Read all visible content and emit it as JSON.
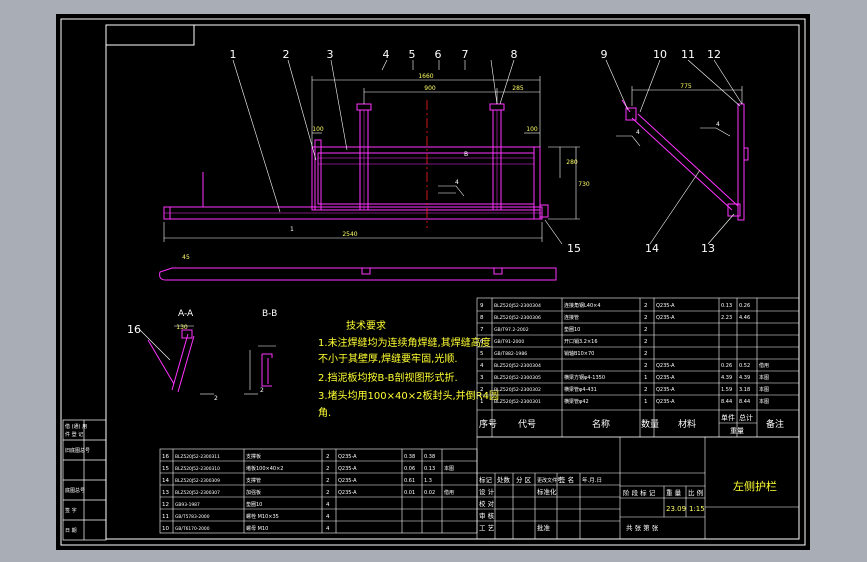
{
  "drawing": {
    "title_block_name": "左侧护栏",
    "weight_value": "23.09",
    "scale_value": "1:15",
    "sheet_text": "共  张  第  张",
    "tech_req_title": "技术要求",
    "tech_req": [
      "1.未注焊缝均为连续角焊缝,其焊缝高度",
      "不小于其壁厚,焊缝要牢固,光顺.",
      "2.挡泥板均按B-B剖视图形式折.",
      "3.堵头均用100×40×2板封头,并倒R4圆",
      "角."
    ],
    "section_aa": "A-A",
    "section_bb": "B-B",
    "section_b_marker": "B",
    "balloons_top": [
      "1",
      "2",
      "3",
      "4",
      "5",
      "6",
      "7",
      "8"
    ],
    "balloons_right": [
      "9",
      "10",
      "11",
      "12"
    ],
    "balloons_other": [
      "15",
      "14",
      "13",
      "16"
    ],
    "dims": {
      "overall": "1660",
      "d900": "900",
      "d285": "285",
      "d2540": "2540",
      "d100a": "100",
      "d100b": "100",
      "d280": "280",
      "d730": "730",
      "d775": "775",
      "d130": "130",
      "d45": "45",
      "r4": "4",
      "r2": "2",
      "r1": "1"
    },
    "parts_table": {
      "rows": [
        {
          "no": "9",
          "code": "BLZ520J52-2300304",
          "name": "连接角钢L40×4",
          "qty": "2",
          "mat": "Q235-A",
          "w1": "0.13",
          "w2": "0.26",
          "note": ""
        },
        {
          "no": "8",
          "code": "BLZ520J52-2300306",
          "name": "连接管",
          "qty": "2",
          "mat": "Q235-A",
          "w1": "2.23",
          "w2": "4.46",
          "note": ""
        },
        {
          "no": "7",
          "code": "GB/T97.2-2002",
          "name": "垫圈10",
          "qty": "2",
          "mat": "",
          "w1": "",
          "w2": "",
          "note": ""
        },
        {
          "no": "6",
          "code": "GB/T91-2000",
          "name": "开口销3.2×16",
          "qty": "2",
          "mat": "",
          "w1": "",
          "w2": "",
          "note": ""
        },
        {
          "no": "5",
          "code": "GB/T882-1986",
          "name": "销轴B10×70",
          "qty": "2",
          "mat": "",
          "w1": "",
          "w2": "",
          "note": ""
        },
        {
          "no": "4",
          "code": "BLZ520J52-2300304",
          "name": "",
          "qty": "2",
          "mat": "Q235-A",
          "w1": "0.26",
          "w2": "0.52",
          "note": "借用"
        },
        {
          "no": "3",
          "code": "BLZ520J52-2300305",
          "name": "横梁方钢φ4-1350",
          "qty": "1",
          "mat": "Q235-A",
          "w1": "4.39",
          "w2": "4.39",
          "note": "本图"
        },
        {
          "no": "2",
          "code": "BLZ520J52-2300302",
          "name": "横梁管φ4-431",
          "qty": "2",
          "mat": "Q235-A",
          "w1": "1.59",
          "w2": "3.18",
          "note": "本图"
        },
        {
          "no": "1",
          "code": "BLZ520J52-2300301",
          "name": "横梁管φ42",
          "qty": "1",
          "mat": "Q235-A",
          "w1": "8.44",
          "w2": "8.44",
          "note": "本图"
        }
      ],
      "headers": {
        "no": "序号",
        "code": "代号",
        "name": "名称",
        "qty": "数量",
        "mat": "材料",
        "single": "单件",
        "total": "总计",
        "weight": "重量",
        "note": "备注"
      }
    },
    "lower_table": {
      "rows": [
        {
          "no": "16",
          "code": "BLZ520J52-2300311",
          "name": "支撑板",
          "qty": "2",
          "mat": "Q235-A",
          "w1": "0.38",
          "w2": "0.38",
          "note": ""
        },
        {
          "no": "15",
          "code": "BLZ520J52-2300310",
          "name": "堵板100×40×2",
          "qty": "2",
          "mat": "Q235-A",
          "w1": "0.06",
          "w2": "0.13",
          "note": "本图"
        },
        {
          "no": "14",
          "code": "BLZ520J52-2300309",
          "name": "支撑管",
          "qty": "2",
          "mat": "Q235-A",
          "w1": "0.61",
          "w2": "1.3",
          "note": ""
        },
        {
          "no": "13",
          "code": "BLZ520J52-2300307",
          "name": "加强板",
          "qty": "2",
          "mat": "Q235-A",
          "w1": "0.01",
          "w2": "0.02",
          "note": "借用"
        },
        {
          "no": "12",
          "code": "GB93-1987",
          "name": "垫圈10",
          "qty": "4",
          "mat": "",
          "w1": "",
          "w2": "",
          "note": ""
        },
        {
          "no": "11",
          "code": "GB/T5783-2000",
          "name": "螺栓 M10×35",
          "qty": "4",
          "mat": "",
          "w1": "",
          "w2": "",
          "note": ""
        },
        {
          "no": "10",
          "code": "GB/T6170-2000",
          "name": "螺母 M10",
          "qty": "4",
          "mat": "",
          "w1": "",
          "w2": "",
          "note": ""
        }
      ]
    },
    "title_rows": {
      "r1": [
        "标记",
        "处数",
        "分 区",
        "更改文件号",
        "签 名",
        "年.月.日"
      ],
      "r2": [
        "设 计",
        "",
        "",
        "标准化"
      ],
      "r3": [
        "校 对"
      ],
      "r4": [
        "审 核"
      ],
      "r5": [
        "工 艺",
        "",
        "",
        "批准"
      ],
      "stage_labels": [
        "阶 段 标 记",
        "重 量",
        "比 例"
      ]
    },
    "left_strip": [
      "借 (通) 用",
      "件 登 记",
      "旧底图总号",
      "底图总号",
      "签 字",
      "日 期"
    ]
  }
}
